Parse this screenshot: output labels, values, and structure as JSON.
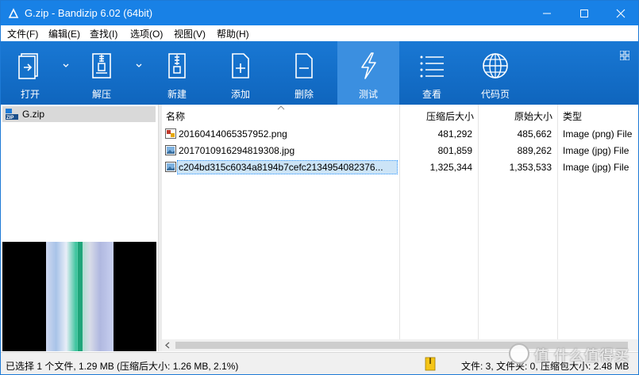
{
  "window": {
    "title": "G.zip - Bandizip 6.02 (64bit)"
  },
  "menu": {
    "items": [
      "文件(F)",
      "编辑(E)",
      "查找(I)",
      "选项(O)",
      "视图(V)",
      "帮助(H)"
    ]
  },
  "toolbar": {
    "buttons": [
      {
        "label": "打开",
        "icon": "open-icon"
      },
      {
        "label": "解压",
        "icon": "extract-icon"
      },
      {
        "label": "新建",
        "icon": "new-archive-icon"
      },
      {
        "label": "添加",
        "icon": "add-icon"
      },
      {
        "label": "删除",
        "icon": "delete-icon"
      },
      {
        "label": "测试",
        "icon": "test-icon"
      },
      {
        "label": "查看",
        "icon": "view-icon"
      },
      {
        "label": "代码页",
        "icon": "codepage-icon"
      }
    ],
    "active": "测试"
  },
  "tree": {
    "root_label": "G.zip"
  },
  "table": {
    "columns": [
      "名称",
      "压缩后大小",
      "原始大小",
      "类型"
    ],
    "rows": [
      {
        "name": "20160414065357952.png",
        "compressed": "481,292",
        "original": "485,662",
        "type": "Image (png) File",
        "icon": "png-file-icon"
      },
      {
        "name": "20170109162948193​08.jpg",
        "compressed": "801,859",
        "original": "889,262",
        "type": "Image (jpg) File",
        "icon": "jpg-file-icon"
      },
      {
        "name": "c204bd315c6034a8194b7cefc2134954082376...",
        "compressed": "1,325,344",
        "original": "1,353,533",
        "type": "Image (jpg) File",
        "icon": "jpg-file-icon",
        "selected": true
      }
    ]
  },
  "status": {
    "left": "已选择 1 个文件, 1.29 MB (压缩后大小: 1.26 MB, 2.1%)",
    "right": "文件: 3, 文件夹: 0, 压缩包大小: 2.48 MB"
  },
  "watermark": {
    "text": "值 什么值得买"
  },
  "colors": {
    "titlebar": "#1881e6",
    "toolbar": "#1978d4",
    "active_button": "#3b8fe0",
    "selection": "#cce4f7"
  }
}
